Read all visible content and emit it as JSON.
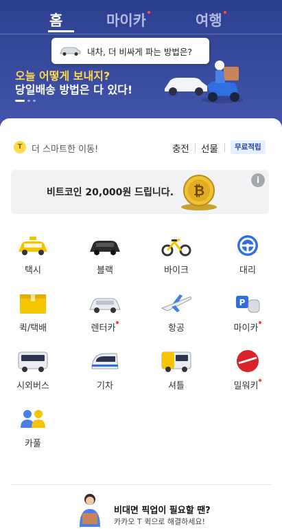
{
  "tabs": [
    {
      "label": "홈",
      "active": true,
      "dot": false
    },
    {
      "label": "마이카",
      "active": false,
      "dot": true
    },
    {
      "label": "여행",
      "active": false,
      "dot": true
    }
  ],
  "tooltip": {
    "text": "내차, 더 비싸게 파는 방법은?"
  },
  "banner": {
    "line1": "오늘 어떻게 보내지?",
    "line2": "당일배송 방법은 다 있다!"
  },
  "smart_row": {
    "text": "더 스마트한 이동!",
    "charge": "충전",
    "gift": "선물",
    "badge": "무료적립"
  },
  "promo": {
    "text": "비트코인 20,000원 드립니다."
  },
  "services": [
    {
      "label": "택시",
      "icon": "taxi-icon",
      "new": false
    },
    {
      "label": "블랙",
      "icon": "black-car-icon",
      "new": false
    },
    {
      "label": "바이크",
      "icon": "bike-icon",
      "new": false
    },
    {
      "label": "대리",
      "icon": "steering-wheel-icon",
      "new": false
    },
    {
      "label": "퀵/택배",
      "icon": "package-box-icon",
      "new": false
    },
    {
      "label": "렌터카",
      "icon": "rental-car-icon",
      "new": true
    },
    {
      "label": "항공",
      "icon": "airplane-icon",
      "new": false
    },
    {
      "label": "마이카",
      "icon": "parking-key-icon",
      "new": true
    },
    {
      "label": "시외버스",
      "icon": "bus-icon",
      "new": false
    },
    {
      "label": "기차",
      "icon": "train-icon",
      "new": false
    },
    {
      "label": "셔틀",
      "icon": "shuttle-icon",
      "new": false
    },
    {
      "label": "밀워키",
      "icon": "milwaukee-logo-icon",
      "new": true
    },
    {
      "label": "카풀",
      "icon": "carpool-people-icon",
      "new": false
    }
  ],
  "footer": {
    "title": "비대면 픽업이 필요할 땐?",
    "subtitle": "카카오 T 퀵으로 해결하세요!"
  },
  "colors": {
    "header": "#3a4ca0",
    "accent_yellow": "#ffd84d",
    "new_dot": "#ff3b3b"
  }
}
